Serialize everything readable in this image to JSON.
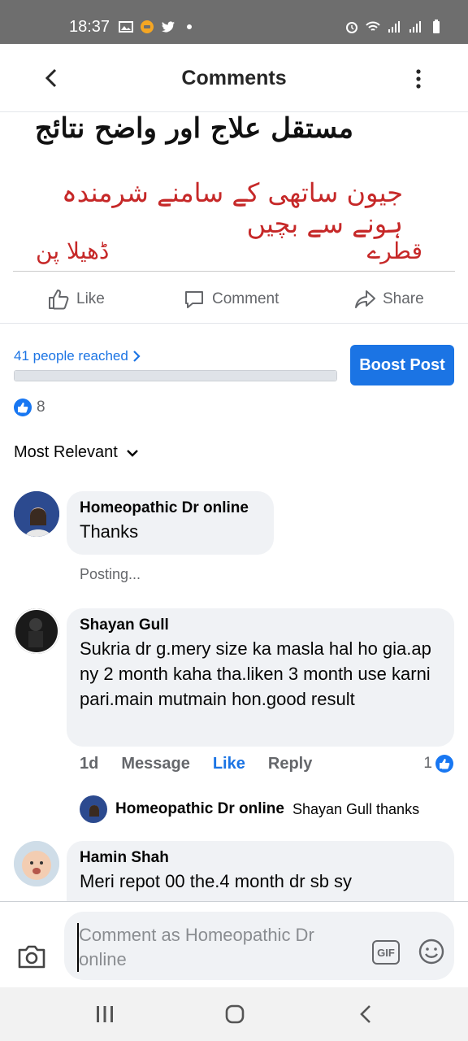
{
  "status_bar": {
    "time": "18:37"
  },
  "header": {
    "title": "Comments"
  },
  "post_image": {
    "line1": "مستقل علاج اور واضح نتائج",
    "line2": "جیون ساتھی کے سامنے شرمندہ ہونے سے بچیں",
    "line3_right": "قطرے",
    "line3_left": "ڈھیلا پن"
  },
  "actions": {
    "like": "Like",
    "comment": "Comment",
    "share": "Share"
  },
  "reach": {
    "label": "41 people reached",
    "boost": "Boost Post"
  },
  "reactions": {
    "count": "8"
  },
  "sort": {
    "label": "Most Relevant"
  },
  "comments": [
    {
      "name": "Homeopathic Dr online",
      "text": "Thanks",
      "status": "Posting..."
    },
    {
      "name": "Shayan Gull",
      "text": "Sukria dr g.mery size ka masla hal ho gia.ap ny 2 month kaha tha.liken 3 month use karni pari.main mutmain hon.good result",
      "age": "1d",
      "message": "Message",
      "like": "Like",
      "reply": "Reply",
      "reaction_count": "1",
      "reply_preview": {
        "name": "Homeopathic Dr online",
        "text": "Shayan Gull thanks"
      }
    },
    {
      "name": "Hamin Shah",
      "text": "Meri repot 00 the.4 month dr sb sy"
    }
  ],
  "composer": {
    "placeholder": "Comment as Homeopathic Dr online",
    "gif": "GIF"
  }
}
